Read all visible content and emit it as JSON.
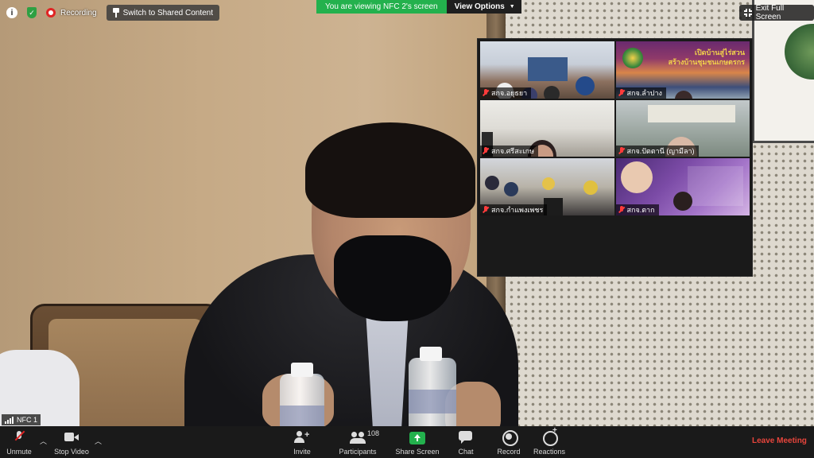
{
  "status": {
    "recording_label": "Recording",
    "switch_button_label": "Switch to Shared Content"
  },
  "banner": {
    "viewing_text": "You are viewing NFC 2's screen",
    "view_options_label": "View Options"
  },
  "exit_fullscreen_label": "Exit Full Screen",
  "gallery": {
    "tiles": [
      {
        "label": "สกจ.อยุธยา"
      },
      {
        "label": "สกจ.ลำปาง"
      },
      {
        "label": "สกจ.ศรีสะเกษ"
      },
      {
        "label": "สกจ.ปัตตานี (ญามีลา)"
      },
      {
        "label": "สกจ.กำแพงเพชร"
      },
      {
        "label": "สกจ.ตาก"
      }
    ],
    "tile2_title_line1": "เปิดบ้านสู่ไร่สวน",
    "tile2_title_line2": "สร้างบ้านชุมชนเกษตรกร"
  },
  "self_view": {
    "name": "NFC 1"
  },
  "toolbar": {
    "unmute_label": "Unmute",
    "stop_video_label": "Stop Video",
    "invite_label": "Invite",
    "participants_label": "Participants",
    "participants_count": "108",
    "share_screen_label": "Share Screen",
    "chat_label": "Chat",
    "record_label": "Record",
    "reactions_label": "Reactions",
    "leave_label": "Leave Meeting"
  },
  "colors": {
    "banner_green": "#23b14d",
    "leave_red": "#e8453c",
    "toolbar_bg": "#1a1a1a"
  }
}
